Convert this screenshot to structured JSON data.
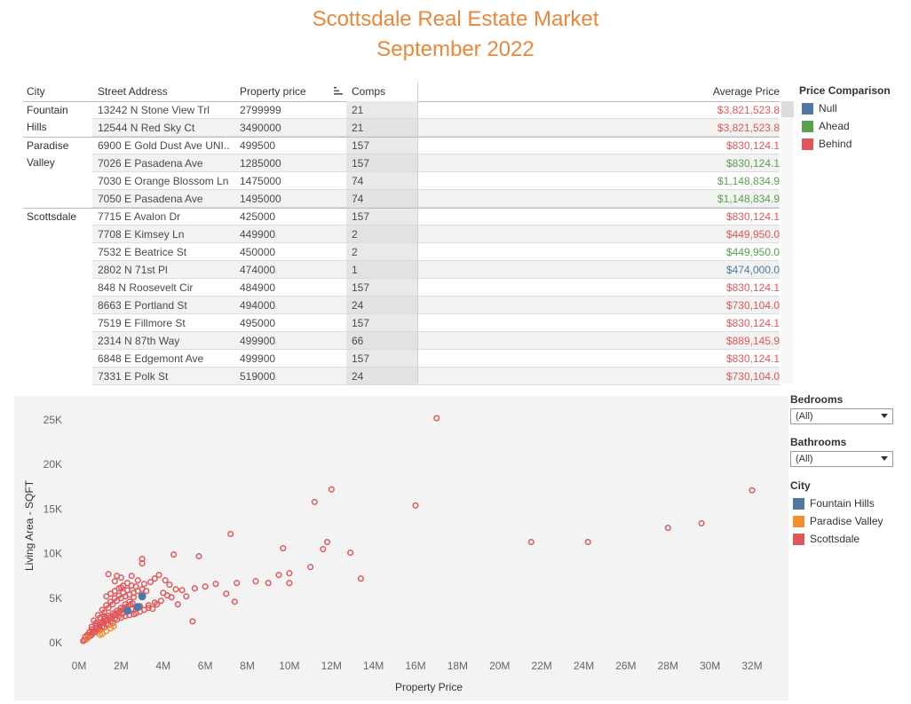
{
  "header": {
    "title_line1": "Scottsdale Real Estate Market",
    "title_line2": "September 2022"
  },
  "table": {
    "columns": {
      "city": "City",
      "address": "Street Address",
      "price": "Property price",
      "comps": "Comps",
      "avg": "Average Price"
    },
    "groups": [
      {
        "city_lines": [
          "Fountain",
          "Hills"
        ],
        "rows": [
          {
            "address": "13242 N Stone View Trl",
            "price": "2799999",
            "comps": "21",
            "avg": "$3,821,523.8",
            "cmp": "Behind"
          },
          {
            "address": "12544 N Red Sky Ct",
            "price": "3490000",
            "comps": "21",
            "avg": "$3,821,523.8",
            "cmp": "Behind"
          }
        ]
      },
      {
        "city_lines": [
          "Paradise",
          "Valley"
        ],
        "rows": [
          {
            "address": "6900 E Gold Dust Ave UNI..",
            "price": "499500",
            "comps": "157",
            "avg": "$830,124.1",
            "cmp": "Behind"
          },
          {
            "address": "7026 E Pasadena Ave",
            "price": "1285000",
            "comps": "157",
            "avg": "$830,124.1",
            "cmp": "Ahead"
          },
          {
            "address": "7030 E Orange Blossom Ln",
            "price": "1475000",
            "comps": "74",
            "avg": "$1,148,834.9",
            "cmp": "Ahead"
          },
          {
            "address": "7050 E Pasadena Ave",
            "price": "1495000",
            "comps": "74",
            "avg": "$1,148,834.9",
            "cmp": "Ahead"
          }
        ]
      },
      {
        "city_lines": [
          "Scottsdale"
        ],
        "rows": [
          {
            "address": "7715 E Avalon Dr",
            "price": "425000",
            "comps": "157",
            "avg": "$830,124.1",
            "cmp": "Behind"
          },
          {
            "address": "7708 E Kimsey Ln",
            "price": "449900",
            "comps": "2",
            "avg": "$449,950.0",
            "cmp": "Behind"
          },
          {
            "address": "7532 E Beatrice St",
            "price": "450000",
            "comps": "2",
            "avg": "$449,950.0",
            "cmp": "Ahead"
          },
          {
            "address": "2802 N 71st Pl",
            "price": "474000",
            "comps": "1",
            "avg": "$474,000.0",
            "cmp": "Null"
          },
          {
            "address": "848 N Roosevelt Cir",
            "price": "484900",
            "comps": "157",
            "avg": "$830,124.1",
            "cmp": "Behind"
          },
          {
            "address": "8663 E Portland St",
            "price": "494000",
            "comps": "24",
            "avg": "$730,104.0",
            "cmp": "Behind"
          },
          {
            "address": "7519 E Fillmore St",
            "price": "495000",
            "comps": "157",
            "avg": "$830,124.1",
            "cmp": "Behind"
          },
          {
            "address": "2314 N 87th Way",
            "price": "499900",
            "comps": "66",
            "avg": "$889,145.9",
            "cmp": "Behind"
          },
          {
            "address": "6848 E Edgemont Ave",
            "price": "499900",
            "comps": "157",
            "avg": "$830,124.1",
            "cmp": "Behind"
          },
          {
            "address": "7331 E Polk St",
            "price": "519000",
            "comps": "24",
            "avg": "$730,104.0",
            "cmp": "Behind"
          }
        ]
      }
    ]
  },
  "price_comparison_legend": {
    "title": "Price Comparison",
    "items": [
      {
        "label": "Null",
        "color": "#4e79a7"
      },
      {
        "label": "Ahead",
        "color": "#59a14f"
      },
      {
        "label": "Behind",
        "color": "#e15759"
      }
    ]
  },
  "text_colors": {
    "Null": "#4e79a7",
    "Ahead": "#59a14f",
    "Behind": "#e15759"
  },
  "filters": {
    "bedrooms": {
      "label": "Bedrooms",
      "value": "(All)"
    },
    "bathrooms": {
      "label": "Bathrooms",
      "value": "(All)"
    }
  },
  "city_legend": {
    "title": "City",
    "items": [
      {
        "label": "Fountain Hills",
        "color": "#4e79a7"
      },
      {
        "label": "Paradise Valley",
        "color": "#f28e2b"
      },
      {
        "label": "Scottsdale",
        "color": "#e15759"
      }
    ]
  },
  "chart_data": {
    "type": "scatter",
    "xlabel": "Property Price",
    "ylabel": "Living Area - SQFT",
    "xlim": [
      0,
      33000000
    ],
    "ylim": [
      0,
      27000
    ],
    "x_ticks": [
      "0M",
      "2M",
      "4M",
      "6M",
      "8M",
      "10M",
      "12M",
      "14M",
      "16M",
      "18M",
      "20M",
      "22M",
      "24M",
      "26M",
      "28M",
      "30M",
      "32M"
    ],
    "x_tick_values": [
      0,
      2000000,
      4000000,
      6000000,
      8000000,
      10000000,
      12000000,
      14000000,
      16000000,
      18000000,
      20000000,
      22000000,
      24000000,
      26000000,
      28000000,
      30000000,
      32000000
    ],
    "y_ticks": [
      "0K",
      "5K",
      "10K",
      "15K",
      "20K",
      "25K"
    ],
    "y_tick_values": [
      0,
      5000,
      10000,
      15000,
      20000,
      25000
    ],
    "series": [
      {
        "name": "Fountain Hills",
        "color": "#4e79a7",
        "filled": true,
        "points": [
          [
            2300000,
            3600
          ],
          [
            3000000,
            5200
          ],
          [
            2800000,
            4000
          ]
        ]
      },
      {
        "name": "Paradise Valley",
        "color": "#f28e2b",
        "filled": false,
        "points": [
          [
            400000,
            500
          ],
          [
            1100000,
            1000
          ],
          [
            1500000,
            1600
          ],
          [
            1300000,
            1300
          ],
          [
            1000000,
            900
          ],
          [
            1650000,
            1850
          ]
        ]
      },
      {
        "name": "Scottsdale",
        "color": "#e15759",
        "filled": false,
        "points": [
          [
            17000000,
            25200
          ],
          [
            11200000,
            15800
          ],
          [
            12000000,
            17200
          ],
          [
            16000000,
            15400
          ],
          [
            32000000,
            17100
          ],
          [
            21500000,
            11300
          ],
          [
            24200000,
            11300
          ],
          [
            28000000,
            12900
          ],
          [
            29600000,
            13400
          ],
          [
            7200000,
            12200
          ],
          [
            9700000,
            10600
          ],
          [
            11800000,
            11300
          ],
          [
            11600000,
            10500
          ],
          [
            12900000,
            10100
          ],
          [
            13400000,
            7200
          ],
          [
            11000000,
            8500
          ],
          [
            10000000,
            7800
          ],
          [
            9500000,
            7600
          ],
          [
            10000000,
            6700
          ],
          [
            9000000,
            6700
          ],
          [
            8400000,
            6900
          ],
          [
            7500000,
            6700
          ],
          [
            6500000,
            6600
          ],
          [
            7000000,
            5500
          ],
          [
            7400000,
            4600
          ],
          [
            5400000,
            2400
          ],
          [
            4500000,
            9900
          ],
          [
            5700000,
            9700
          ],
          [
            3000000,
            9400
          ],
          [
            3000000,
            8900
          ],
          [
            1400000,
            7700
          ],
          [
            1800000,
            7500
          ],
          [
            1700000,
            6900
          ],
          [
            2000000,
            6200
          ],
          [
            2500000,
            6400
          ],
          [
            3800000,
            7600
          ],
          [
            4100000,
            7000
          ],
          [
            4300000,
            6500
          ],
          [
            4900000,
            5900
          ],
          [
            5500000,
            6100
          ],
          [
            6000000,
            6300
          ],
          [
            4000000,
            5600
          ],
          [
            4400000,
            5100
          ],
          [
            4700000,
            4300
          ],
          [
            3600000,
            4500
          ],
          [
            3300000,
            4200
          ],
          [
            3900000,
            4700
          ],
          [
            3200000,
            5800
          ],
          [
            2900000,
            4100
          ],
          [
            2600000,
            5100
          ],
          [
            2400000,
            4600
          ],
          [
            2200000,
            4300
          ],
          [
            2000000,
            3900
          ],
          [
            1800000,
            3600
          ],
          [
            1600000,
            3300
          ],
          [
            1400000,
            3000
          ],
          [
            1200000,
            2700
          ],
          [
            1000000,
            2300
          ],
          [
            800000,
            1900
          ],
          [
            600000,
            1500
          ],
          [
            500000,
            1200
          ],
          [
            400000,
            900
          ],
          [
            300000,
            700
          ],
          [
            700000,
            2500
          ],
          [
            900000,
            3100
          ],
          [
            1100000,
            3700
          ],
          [
            1300000,
            4200
          ],
          [
            1500000,
            4600
          ],
          [
            1700000,
            5000
          ],
          [
            1900000,
            5300
          ],
          [
            2100000,
            5600
          ],
          [
            2300000,
            5900
          ],
          [
            2700000,
            6300
          ],
          [
            3100000,
            6600
          ],
          [
            900000,
            1400
          ],
          [
            1100000,
            1800
          ],
          [
            1300000,
            2100
          ],
          [
            1500000,
            2400
          ],
          [
            1700000,
            2700
          ],
          [
            1900000,
            3000
          ],
          [
            2100000,
            3300
          ],
          [
            2300000,
            3500
          ],
          [
            2500000,
            3800
          ],
          [
            2700000,
            4000
          ],
          [
            650000,
            1100
          ],
          [
            750000,
            1300
          ],
          [
            850000,
            1600
          ],
          [
            950000,
            1900
          ],
          [
            1050000,
            2100
          ],
          [
            1150000,
            2300
          ],
          [
            1250000,
            2500
          ],
          [
            1350000,
            2600
          ],
          [
            1450000,
            2800
          ],
          [
            1550000,
            2900
          ],
          [
            1650000,
            3100
          ],
          [
            1750000,
            3200
          ],
          [
            1850000,
            3400
          ],
          [
            1950000,
            3500
          ],
          [
            2050000,
            3700
          ],
          [
            2150000,
            3800
          ],
          [
            2250000,
            4000
          ],
          [
            2350000,
            4100
          ],
          [
            2450000,
            4300
          ],
          [
            2550000,
            4400
          ],
          [
            450000,
            600
          ],
          [
            550000,
            800
          ],
          [
            350000,
            400
          ],
          [
            250000,
            300
          ],
          [
            200000,
            200
          ],
          [
            1200000,
            3400
          ],
          [
            1400000,
            3900
          ],
          [
            1600000,
            4300
          ],
          [
            1800000,
            4700
          ],
          [
            2000000,
            5000
          ],
          [
            2200000,
            5200
          ],
          [
            2400000,
            5400
          ],
          [
            2600000,
            5600
          ],
          [
            2800000,
            5800
          ],
          [
            3000000,
            6000
          ],
          [
            1000000,
            2800
          ],
          [
            1200000,
            3000
          ],
          [
            800000,
            2200
          ],
          [
            600000,
            1800
          ],
          [
            1300000,
            5200
          ],
          [
            1500000,
            5500
          ],
          [
            1700000,
            5800
          ],
          [
            1900000,
            6100
          ],
          [
            2100000,
            6400
          ],
          [
            2300000,
            6700
          ],
          [
            3400000,
            6800
          ],
          [
            3600000,
            7200
          ],
          [
            2000000,
            7300
          ],
          [
            2800000,
            7000
          ],
          [
            2500000,
            7500
          ],
          [
            4600000,
            6000
          ],
          [
            5100000,
            5200
          ],
          [
            3500000,
            3800
          ],
          [
            3700000,
            4300
          ],
          [
            4200000,
            5300
          ],
          [
            2700000,
            3300
          ],
          [
            2900000,
            3500
          ],
          [
            3100000,
            3700
          ],
          [
            3300000,
            3900
          ],
          [
            1800000,
            2600
          ],
          [
            2000000,
            2800
          ],
          [
            2200000,
            3000
          ],
          [
            2400000,
            3100
          ],
          [
            2600000,
            3200
          ],
          [
            1600000,
            2200
          ],
          [
            1400000,
            2000
          ],
          [
            1200000,
            1700
          ],
          [
            1000000,
            1500
          ],
          [
            800000,
            1200
          ],
          [
            600000,
            900
          ]
        ]
      }
    ]
  }
}
